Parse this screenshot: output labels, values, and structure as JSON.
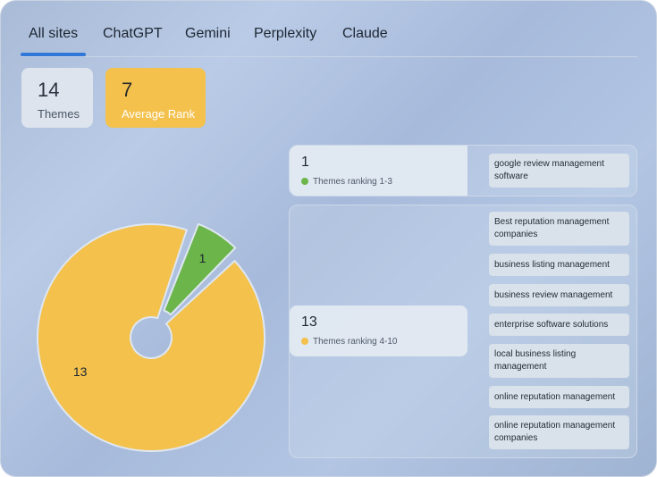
{
  "tabs": [
    {
      "label": "All sites",
      "active": true
    },
    {
      "label": "ChatGPT",
      "active": false
    },
    {
      "label": "Gemini",
      "active": false
    },
    {
      "label": "Perplexity",
      "active": false
    },
    {
      "label": "Claude",
      "active": false
    }
  ],
  "stats": {
    "themes": {
      "value": "14",
      "label": "Themes"
    },
    "average_rank": {
      "value": "7",
      "label": "Average Rank"
    }
  },
  "colors": {
    "accent": "#2f78d8",
    "top_tier": "#6cb54b",
    "mid_tier": "#f3c14c"
  },
  "groups": [
    {
      "count": "1",
      "legend": "Themes ranking 1-3",
      "color": "#6cb54b",
      "themes": [
        "google review management software"
      ]
    },
    {
      "count": "13",
      "legend": "Themes ranking 4-10",
      "color": "#f3c14c",
      "themes": [
        "Best reputation management companies",
        "business listing management",
        "business review management",
        "enterprise software solutions",
        "local business listing management",
        "online reputation management",
        "online reputation management companies"
      ]
    }
  ],
  "chart_data": {
    "type": "pie",
    "categories": [
      "Themes ranking 1-3",
      "Themes ranking 4-10"
    ],
    "values": [
      1,
      13
    ],
    "data_labels": [
      "1",
      "13"
    ],
    "donut": true,
    "colors": [
      "#6cb54b",
      "#f3c14c"
    ]
  }
}
